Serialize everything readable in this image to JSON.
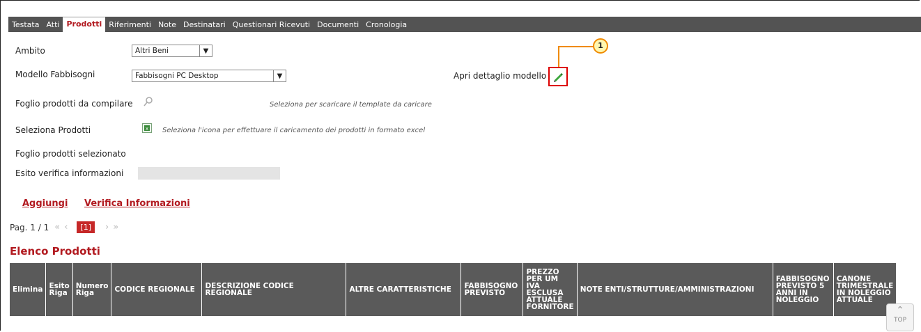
{
  "tabs": [
    "Testata",
    "Atti",
    "Prodotti",
    "Riferimenti",
    "Note",
    "Destinatari",
    "Questionari Ricevuti",
    "Documenti",
    "Cronologia"
  ],
  "active_tab": "Prodotti",
  "form": {
    "ambito_label": "Ambito",
    "ambito_value": "Altri Beni",
    "modello_label": "Modello Fabbisogni",
    "modello_value": "Fabbisogni PC Desktop",
    "apri_label": "Apri dettaglio modello",
    "foglio_label": "Foglio prodotti da compilare",
    "foglio_hint": "Seleziona per scaricare il template da caricare",
    "seleziona_label": "Seleziona Prodotti",
    "seleziona_hint": "Seleziona l'icona per effettuare il caricamento dei prodotti in formato excel",
    "foglio_sel_label": "Foglio prodotti selezionato",
    "esito_label": "Esito verifica informazioni"
  },
  "actions": {
    "aggiungi": "Aggiungi",
    "verifica": "Verifica Informazioni"
  },
  "pagination": {
    "label": "Pag. 1 / 1",
    "first": "«",
    "prev": "‹",
    "current": "[1]",
    "next": "›",
    "last": "»"
  },
  "section_title": "Elenco Prodotti",
  "table": {
    "headers": [
      "Elimina",
      "Esito Riga",
      "Numero Riga",
      "CODICE REGIONALE",
      "DESCRIZIONE CODICE REGIONALE",
      "ALTRE CARATTERISTICHE",
      "FABBISOGNO PREVISTO",
      "PREZZO PER UM IVA ESCLUSA ATTUALE FORNITORE",
      "NOTE ENTI/STRUTTURE/AMMINISTRAZIONI",
      "FABBISOGNO PREVISTO 5 ANNI IN NOLEGGIO",
      "CANONE TRIMESTRALE IN NOLEGGIO ATTUALE"
    ]
  },
  "callout_number": "1",
  "top_label": "TOP"
}
